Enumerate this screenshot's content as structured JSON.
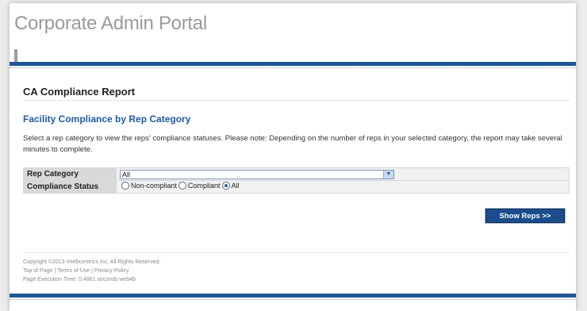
{
  "header": {
    "portal_title": "Corporate Admin Portal"
  },
  "report": {
    "title": "CA Compliance Report",
    "section_title": "Facility Compliance by Rep Category",
    "description": "Select a rep category to view the reps' compliance statuses. Please note: Depending on the number of reps in your selected category, the report may take several minutes to complete."
  },
  "form": {
    "rep_category_label": "Rep Category",
    "rep_category_value": "All",
    "compliance_status_label": "Compliance Status",
    "status_options": [
      "Non-compliant",
      "Compliant",
      "All"
    ],
    "selected_status": "All"
  },
  "actions": {
    "show_reps": "Show Reps >>"
  },
  "footer": {
    "copyright": "Copyright ©2013 Intellicentrics Inc. All Rights Reserved.",
    "links": [
      "Top of Page",
      "Terms of Use",
      "Privacy Policy"
    ],
    "execution_time": "Page Execution Time: 0.4861 seconds web4b"
  },
  "colors": {
    "brand_blue": "#1f5596",
    "button_blue": "#1b4d8c",
    "section_blue": "#1f5aa5"
  }
}
